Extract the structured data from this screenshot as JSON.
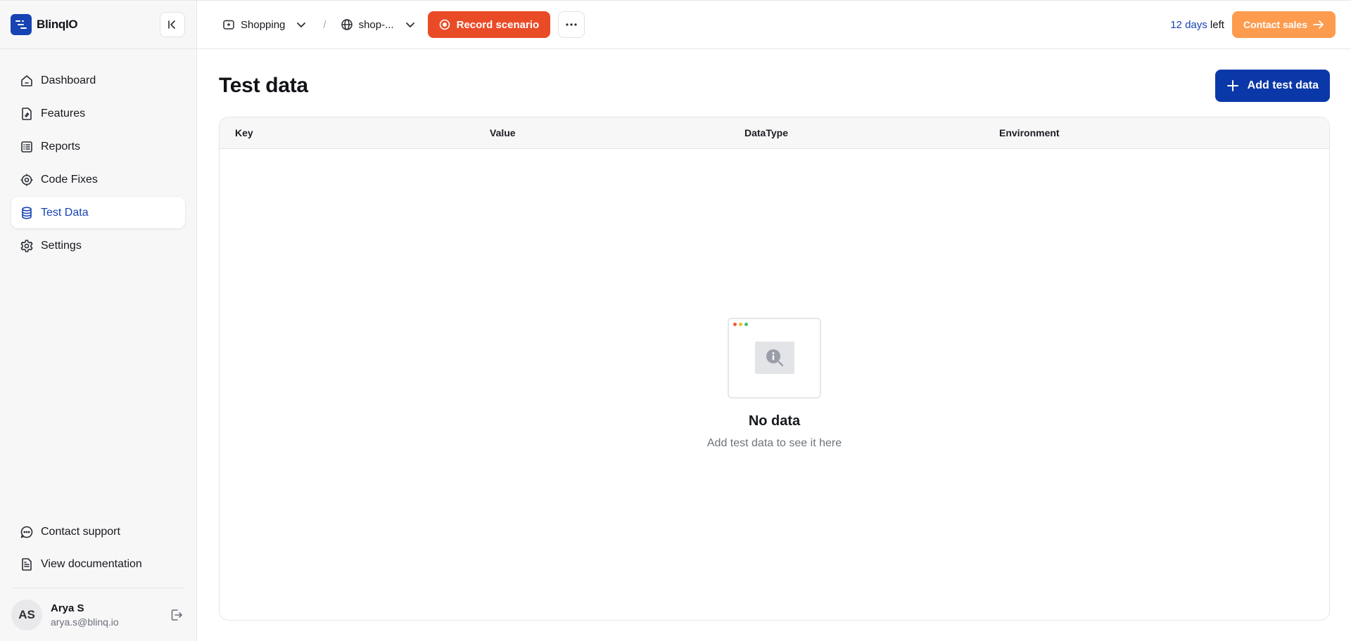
{
  "brand": {
    "name": "BlinqIO",
    "accent": "#1743b3"
  },
  "sidebar": {
    "items": [
      {
        "label": "Dashboard",
        "icon": "home-icon",
        "active": false
      },
      {
        "label": "Features",
        "icon": "feature-file-icon",
        "active": false
      },
      {
        "label": "Reports",
        "icon": "report-list-icon",
        "active": false
      },
      {
        "label": "Code Fixes",
        "icon": "code-fix-gear-icon",
        "active": false
      },
      {
        "label": "Test Data",
        "icon": "database-icon",
        "active": true
      },
      {
        "label": "Settings",
        "icon": "gear-icon",
        "active": false
      }
    ],
    "bottom": [
      {
        "label": "Contact support",
        "icon": "chat-bubble-icon"
      },
      {
        "label": "View documentation",
        "icon": "document-icon"
      }
    ],
    "user": {
      "initials": "AS",
      "name": "Arya S",
      "email": "arya.s@blinq.io"
    }
  },
  "topbar": {
    "project": "Shopping",
    "separator": "/",
    "environment": "shop-...",
    "record_label": "Record scenario",
    "trial_days": "12 days",
    "trial_suffix": " left",
    "contact_label": "Contact sales",
    "record_color": "#ea4b27",
    "contact_color": "#fd9b4e"
  },
  "main": {
    "title": "Test data",
    "add_label": "Add test data",
    "table": {
      "columns": [
        "Key",
        "Value",
        "DataType",
        "Environment"
      ],
      "rows": []
    },
    "empty": {
      "title": "No data",
      "subtitle": "Add test data to see it here"
    }
  }
}
